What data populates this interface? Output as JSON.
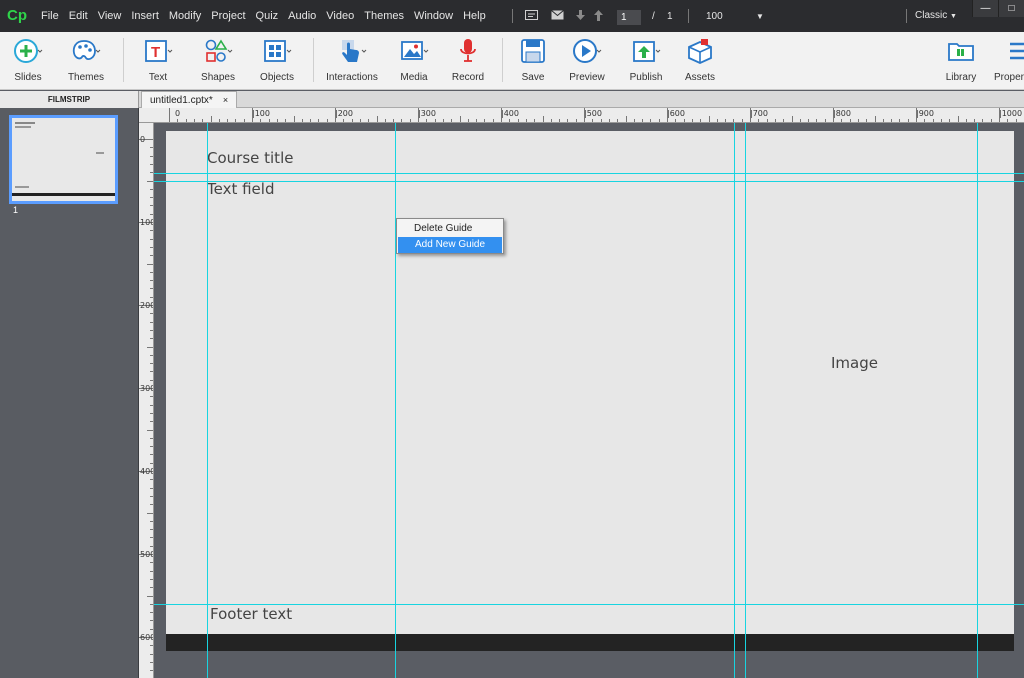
{
  "app": {
    "logo": "Cp"
  },
  "menu": [
    "File",
    "Edit",
    "View",
    "Insert",
    "Modify",
    "Project",
    "Quiz",
    "Audio",
    "Video",
    "Themes",
    "Window",
    "Help"
  ],
  "nav": {
    "current_page": "1",
    "separator": "/",
    "total_pages": "1",
    "zoom": "100"
  },
  "workspace": "Classic",
  "window_buttons": [
    "—",
    "□",
    "✕"
  ],
  "toolbar": {
    "slides": "Slides",
    "themes": "Themes",
    "text": "Text",
    "shapes": "Shapes",
    "objects": "Objects",
    "interactions": "Interactions",
    "media": "Media",
    "record": "Record",
    "save": "Save",
    "preview": "Preview",
    "publish": "Publish",
    "assets": "Assets",
    "library": "Library",
    "properties": "Properties"
  },
  "filmstrip": {
    "title": "FILMSTRIP",
    "slide_number": "1"
  },
  "document": {
    "tab_label": "untitled1.cptx*",
    "close": "×"
  },
  "ruler": {
    "top_labels": [
      "0",
      "100",
      "200",
      "300",
      "400",
      "500",
      "600",
      "700",
      "800",
      "900",
      "1000"
    ],
    "left_labels": [
      "0",
      "100",
      "200",
      "300",
      "400",
      "500",
      "600"
    ]
  },
  "slide": {
    "course_title": "Course title",
    "text_field": "Text field",
    "image_label": "Image",
    "footer_text": "Footer text"
  },
  "context_menu": {
    "items": [
      "Delete Guide",
      "Add New Guide"
    ],
    "highlighted": "Add New Guide"
  },
  "colors": {
    "guide": "#18d4e0",
    "selection": "#3390f0",
    "thumb_border": "#5b9dff",
    "logo": "#2fd44a"
  }
}
